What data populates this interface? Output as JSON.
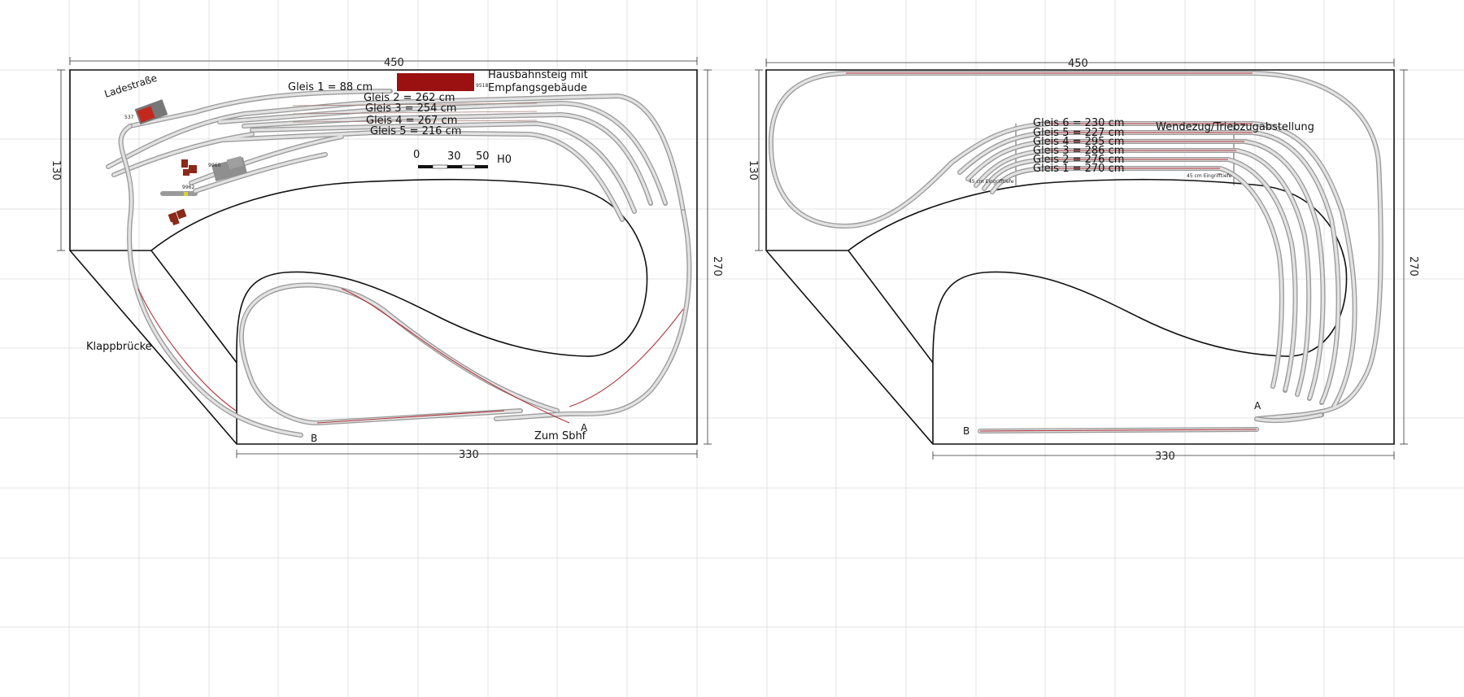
{
  "left_plan": {
    "dim_top": "450",
    "dim_left": "130",
    "dim_right": "270",
    "dim_bottom": "330",
    "label_ladestrasse": "Ladestraße",
    "label_gleis1": "Gleis 1 = 88 cm",
    "label_gleis2": "Gleis 2 = 262 cm",
    "label_gleis3": "Gleis 3 = 254 cm",
    "label_gleis4": "Gleis 4 = 267 cm",
    "label_gleis5": "Gleis 5 = 216 cm",
    "label_hausbahnsteig_1": "Hausbahnsteig mit",
    "label_hausbahnsteig_2": "Empfangsgebäude",
    "label_9518": "9518",
    "label_537": "537",
    "label_9960": "9960",
    "label_9962": "9962",
    "scale_0": "0",
    "scale_30": "30",
    "scale_50": "50",
    "scale_unit": "H0",
    "label_klappbruecke": "Klappbrücke",
    "label_zum_sbhf": "Zum Sbhf",
    "label_a": "A",
    "label_b": "B"
  },
  "right_plan": {
    "dim_top": "450",
    "dim_left": "130",
    "dim_right": "270",
    "dim_bottom": "330",
    "label_gleis6": "Gleis 6 = 230 cm",
    "label_gleis5": "Gleis 5 = 227 cm",
    "label_gleis4": "Gleis 4 = 295 cm",
    "label_gleis3": "Gleis 3 = 286 cm",
    "label_gleis2": "Gleis 2 = 276 cm",
    "label_gleis1": "Gleis 1 = 270 cm",
    "label_wendezug": "Wendezug/Triebzugabstellung",
    "label_eingriff_left": "45 cm Eingrifftiefe",
    "label_eingriff_right": "45 cm Eingrifftiefe",
    "label_a": "A",
    "label_b": "B"
  },
  "colors": {
    "grid": "#e3e3e3",
    "board_outline": "#111111",
    "track_sleepers": "#9a9a9a",
    "hidden_track_rail": "#b0333a",
    "station_building": "#9b1010",
    "buildings_red": "#8b2a1a",
    "building_grey": "#8f8f8f"
  }
}
